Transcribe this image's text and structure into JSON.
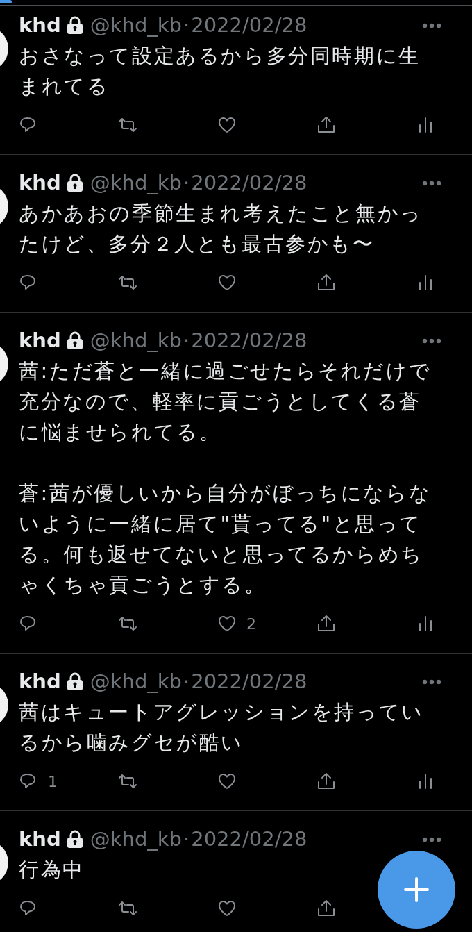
{
  "tweets": [
    {
      "name": "khd",
      "protected": true,
      "handle": "@khd_kb",
      "separator": "·",
      "date": "2022/02/28",
      "paragraphs": [
        "おさなって設定あるから多分同時期に生まれてる"
      ],
      "actions": [
        {
          "kind": "reply"
        },
        {
          "kind": "retweet"
        },
        {
          "kind": "like"
        },
        {
          "kind": "share"
        },
        {
          "kind": "analytics"
        }
      ]
    },
    {
      "name": "khd",
      "protected": true,
      "handle": "@khd_kb",
      "separator": "·",
      "date": "2022/02/28",
      "paragraphs": [
        "あかあおの季節生まれ考えたこと無かったけど、多分２人とも最古参かも〜"
      ],
      "actions": [
        {
          "kind": "reply"
        },
        {
          "kind": "retweet"
        },
        {
          "kind": "like"
        },
        {
          "kind": "share"
        },
        {
          "kind": "analytics"
        }
      ]
    },
    {
      "name": "khd",
      "protected": true,
      "handle": "@khd_kb",
      "separator": "·",
      "date": "2022/02/28",
      "paragraphs": [
        "茜:ただ蒼と一緒に過ごせたらそれだけで充分なので、軽率に貢ごうとしてくる蒼に悩ませられてる。",
        "蒼:茜が優しいから自分がぼっちにならないように一緒に居て\"貰ってる\"と思ってる。何も返せてないと思ってるからめちゃくちゃ貢ごうとする。"
      ],
      "actions": [
        {
          "kind": "reply"
        },
        {
          "kind": "retweet"
        },
        {
          "kind": "like",
          "count": "2"
        },
        {
          "kind": "share"
        },
        {
          "kind": "analytics"
        }
      ]
    },
    {
      "name": "khd",
      "protected": true,
      "handle": "@khd_kb",
      "separator": "·",
      "date": "2022/02/28",
      "paragraphs": [
        "茜はキュートアグレッションを持っているから噛みグセが酷い"
      ],
      "actions": [
        {
          "kind": "reply",
          "count": "1"
        },
        {
          "kind": "retweet"
        },
        {
          "kind": "like"
        },
        {
          "kind": "share"
        },
        {
          "kind": "analytics"
        }
      ]
    },
    {
      "name": "khd",
      "protected": true,
      "handle": "@khd_kb",
      "separator": "·",
      "date": "2022/02/28",
      "paragraphs": [
        "行為中"
      ],
      "actions": [
        {
          "kind": "reply"
        },
        {
          "kind": "retweet"
        },
        {
          "kind": "like"
        },
        {
          "kind": "share"
        }
      ]
    }
  ]
}
